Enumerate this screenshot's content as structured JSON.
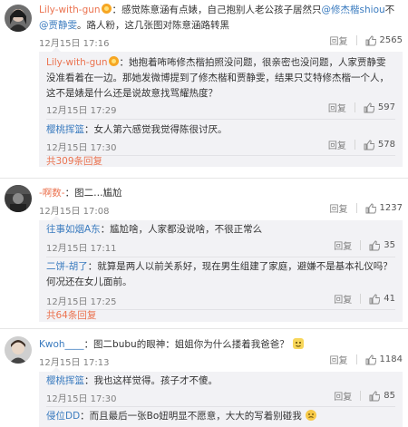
{
  "comments": [
    {
      "user": "Lily-with-gun",
      "text_pre": "：感觉陈意涵有点婊，自己抱别人老公孩子居然只",
      "mention1": "@修杰楷shiou",
      "text_mid": "不",
      "mention2": "@贾静雯",
      "text_post": "。路人粉，这几张图对陈意涵路转黑",
      "time": "12月15日 17:16",
      "reply": "回复",
      "likes": "2565",
      "replies": [
        {
          "user": "Lily-with-gun",
          "text": "：她抱着咘咘修杰楷拍照没问题，很亲密也没问题，人家贾静雯没准看着在一边。那她发微博提到了修杰楷和贾静雯，结果只艾特修杰楷一个人，这不是婊是什么还是说故意找骂耀热度？",
          "time": "12月15日 17:29",
          "reply": "回复",
          "likes": "597"
        },
        {
          "user": "樱桃挥篮",
          "text": "：女人第六感觉我觉得陈很讨厌。",
          "time": "12月15日 17:30",
          "reply": "回复",
          "likes": "578"
        }
      ],
      "more_replies": "共309条回复"
    },
    {
      "user": "-啊数-",
      "text": "：图二…尴尬",
      "time": "12月15日 17:08",
      "reply": "回复",
      "likes": "1237",
      "replies": [
        {
          "user": "往事如烟A东",
          "text": "：尴尬啥，人家都没说啥，不很正常么",
          "time": "12月15日 17:11",
          "reply": "回复",
          "likes": "35"
        },
        {
          "user": "二饼-胡了",
          "text": "：就算是两人以前关系好，现在男生组建了家庭，避嫌不是基本礼仪吗？何况还在女儿面前。",
          "time": "12月15日 17:25",
          "reply": "回复",
          "likes": "41"
        }
      ],
      "more_replies": "共64条回复"
    },
    {
      "user": "Kwoh____",
      "text": "：图二bubu的眼神：姐姐你为什么搂着我爸爸？",
      "time": "12月15日 17:13",
      "reply": "回复",
      "likes": "1184",
      "replies": [
        {
          "user": "樱桃挥篮",
          "text": "：我也这样觉得。孩子才不傻。",
          "time": "12月15日 17:30",
          "reply": "回复",
          "likes": "85"
        },
        {
          "user": "侵位DD",
          "text": "：而且最后一张Bo妞明显不愿意，大大的写着别碰我"
        }
      ]
    }
  ]
}
